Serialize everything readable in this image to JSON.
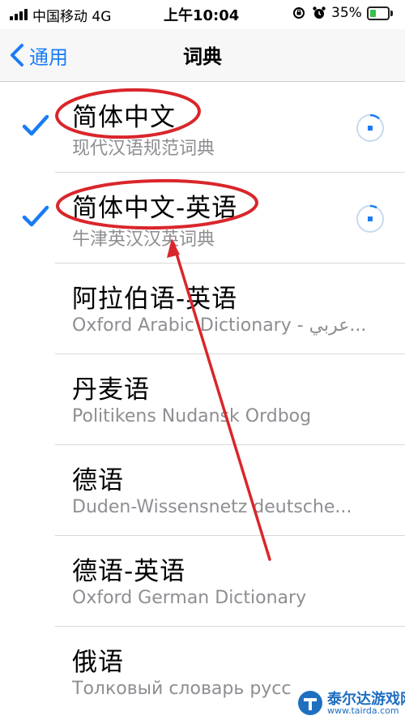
{
  "status_bar": {
    "carrier": "中国移动  4G",
    "time": "上午10:04",
    "battery_percent": "35%",
    "battery_level": 0.35
  },
  "nav": {
    "back_label": "通用",
    "title": "词典"
  },
  "dictionaries": [
    {
      "title": "简体中文",
      "subtitle": "现代汉语规范词典",
      "checked": true,
      "downloading": true
    },
    {
      "title": "简体中文-英语",
      "subtitle": "牛津英汉汉英词典",
      "checked": true,
      "downloading": true
    },
    {
      "title": "阿拉伯语-英语",
      "subtitle": "Oxford Arabic Dictionary - عربي...",
      "checked": false,
      "downloading": false
    },
    {
      "title": "丹麦语",
      "subtitle": "Politikens Nudansk Ordbog",
      "checked": false,
      "downloading": false
    },
    {
      "title": "德语",
      "subtitle": "Duden-Wissensnetz deutsche...",
      "checked": false,
      "downloading": false
    },
    {
      "title": "德语-英语",
      "subtitle": "Oxford German Dictionary",
      "checked": false,
      "downloading": false
    },
    {
      "title": "俄语",
      "subtitle": "Толковый словарь русс",
      "checked": false,
      "downloading": false
    }
  ],
  "watermark": {
    "name": "泰尔达游戏网",
    "url": "www.tairda.com"
  },
  "colors": {
    "accent": "#1a7cf5",
    "annotation": "#d9262b",
    "secondary_text": "#8e8e93"
  }
}
